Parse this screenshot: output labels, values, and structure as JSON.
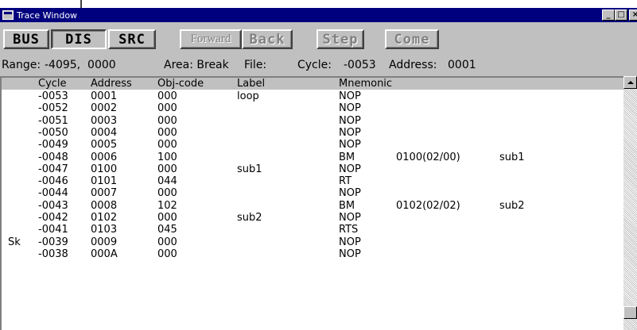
{
  "window": {
    "title": "Trace Window"
  },
  "title_buttons": {
    "minimize": "_",
    "maximize": "□",
    "close": "×"
  },
  "toolbar": {
    "bus": "BUS",
    "dis": "DIS",
    "src": "SRC",
    "forward": "Forward",
    "back": "Back",
    "step": "Step",
    "come": "Come"
  },
  "status": {
    "range_label": "Range:",
    "range_value": "-4095,  0000",
    "area_label": "Area: Break",
    "file_label": "File:",
    "cycle_label": "Cycle:",
    "cycle_value": "-0053",
    "address_label": "Address:",
    "address_value": "0001"
  },
  "columns": {
    "cycle": "Cycle",
    "address": "Address",
    "obj": "Obj-code",
    "label": "Label",
    "mnemonic": "Mnemonic"
  },
  "rows": [
    {
      "mark": "",
      "cycle": "-0053",
      "address": "0001",
      "obj": "000",
      "label": "loop",
      "mnemonic": "NOP",
      "operand": "",
      "symbol": ""
    },
    {
      "mark": "",
      "cycle": "-0052",
      "address": "0002",
      "obj": "000",
      "label": "",
      "mnemonic": "NOP",
      "operand": "",
      "symbol": ""
    },
    {
      "mark": "",
      "cycle": "-0051",
      "address": "0003",
      "obj": "000",
      "label": "",
      "mnemonic": "NOP",
      "operand": "",
      "symbol": ""
    },
    {
      "mark": "",
      "cycle": "-0050",
      "address": "0004",
      "obj": "000",
      "label": "",
      "mnemonic": "NOP",
      "operand": "",
      "symbol": ""
    },
    {
      "mark": "",
      "cycle": "-0049",
      "address": "0005",
      "obj": "000",
      "label": "",
      "mnemonic": "NOP",
      "operand": "",
      "symbol": ""
    },
    {
      "mark": "",
      "cycle": "-0048",
      "address": "0006",
      "obj": "100",
      "label": "",
      "mnemonic": "BM",
      "operand": "0100(02/00)",
      "symbol": "sub1"
    },
    {
      "mark": "",
      "cycle": "-0047",
      "address": "0100",
      "obj": "000",
      "label": "sub1",
      "mnemonic": "NOP",
      "operand": "",
      "symbol": ""
    },
    {
      "mark": "",
      "cycle": "-0046",
      "address": "0101",
      "obj": "044",
      "label": "",
      "mnemonic": "RT",
      "operand": "",
      "symbol": ""
    },
    {
      "mark": "",
      "cycle": "-0044",
      "address": "0007",
      "obj": "000",
      "label": "",
      "mnemonic": "NOP",
      "operand": "",
      "symbol": ""
    },
    {
      "mark": "",
      "cycle": "-0043",
      "address": "0008",
      "obj": "102",
      "label": "",
      "mnemonic": "BM",
      "operand": "0102(02/02)",
      "symbol": "sub2"
    },
    {
      "mark": "",
      "cycle": "-0042",
      "address": "0102",
      "obj": "000",
      "label": "sub2",
      "mnemonic": "NOP",
      "operand": "",
      "symbol": ""
    },
    {
      "mark": "",
      "cycle": "-0041",
      "address": "0103",
      "obj": "045",
      "label": "",
      "mnemonic": "RTS",
      "operand": "",
      "symbol": ""
    },
    {
      "mark": "Sk",
      "cycle": "-0039",
      "address": "0009",
      "obj": "000",
      "label": "",
      "mnemonic": "NOP",
      "operand": "",
      "symbol": ""
    },
    {
      "mark": "",
      "cycle": "-0038",
      "address": "000A",
      "obj": "000",
      "label": "",
      "mnemonic": "NOP",
      "operand": "",
      "symbol": ""
    }
  ]
}
